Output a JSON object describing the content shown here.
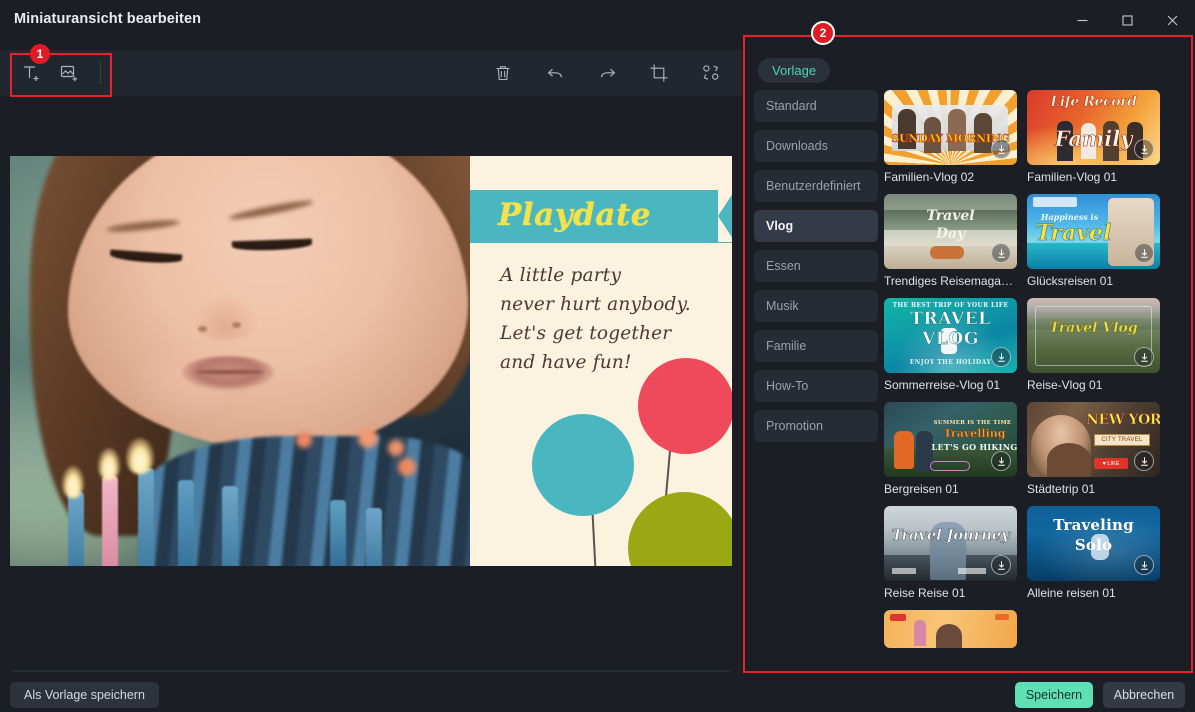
{
  "window": {
    "title": "Miniaturansicht bearbeiten",
    "controls": [
      {
        "name": "minimize",
        "glyph": "minimize-icon"
      },
      {
        "name": "maximize",
        "glyph": "maximize-icon"
      },
      {
        "name": "close",
        "glyph": "close-icon"
      }
    ]
  },
  "toolbar": {
    "left_tools": [
      {
        "name": "add-text-icon",
        "label": "Text hinzufügen"
      },
      {
        "name": "add-image-icon",
        "label": "Bild hinzufügen"
      }
    ],
    "right_tools": [
      {
        "name": "delete-icon",
        "label": "Löschen"
      },
      {
        "name": "undo-icon",
        "label": "Rückgängig"
      },
      {
        "name": "redo-icon",
        "label": "Wiederholen"
      },
      {
        "name": "crop-icon",
        "label": "Zuschneiden"
      },
      {
        "name": "transform-icon",
        "label": "Transformieren"
      }
    ]
  },
  "markers": [
    {
      "number": "1",
      "target": "toolbar-left-tools"
    },
    {
      "number": "2",
      "target": "template-panel"
    }
  ],
  "preview": {
    "ribbon_text": "Playdate",
    "body_lines": [
      "A little party",
      "never hurt anybody.",
      "Let's get together",
      "and have fun!"
    ],
    "colors": {
      "ribbon": "#49b6c0",
      "ribbon_text": "#f3e24a",
      "card_bg": "#fbf2e0",
      "balloon_red": "#ef4a5c",
      "balloon_teal": "#49b6c0",
      "balloon_olive": "#9aa814"
    }
  },
  "template_panel": {
    "tab": "Vorlage",
    "categories": [
      {
        "label": "Standard",
        "active": false
      },
      {
        "label": "Downloads",
        "active": false
      },
      {
        "label": "Benutzerdefiniert",
        "active": false
      },
      {
        "label": "Vlog",
        "active": true
      },
      {
        "label": "Essen",
        "active": false
      },
      {
        "label": "Musik",
        "active": false
      },
      {
        "label": "Familie",
        "active": false
      },
      {
        "label": "How-To",
        "active": false
      },
      {
        "label": "Promotion",
        "active": false
      }
    ],
    "templates": [
      {
        "label": "Familien-Vlog 02",
        "overlay": "SUNDAY MORNING",
        "downloadable": true,
        "style": "fam02"
      },
      {
        "label": "Familien-Vlog 01",
        "overlay": "Life Record Family",
        "downloadable": true,
        "style": "fam01"
      },
      {
        "label": "Trendiges Reisemagazi...",
        "overlay": "Travel Day",
        "downloadable": true,
        "style": "travelday"
      },
      {
        "label": "Glücksreisen 01",
        "overlay": "Travel",
        "downloadable": true,
        "style": "happytravel"
      },
      {
        "label": "Sommerreise-Vlog 01",
        "overlay": "TRAVEL VLOG",
        "downloadable": true,
        "style": "summer"
      },
      {
        "label": "Reise-Vlog 01",
        "overlay": "Travel Vlog",
        "downloadable": true,
        "style": "reisevlog"
      },
      {
        "label": "Bergreisen 01",
        "overlay": "LET'S GO HIKING",
        "downloadable": true,
        "style": "berg"
      },
      {
        "label": "Städtetrip 01",
        "overlay": "NEW YORK",
        "downloadable": true,
        "style": "newyork"
      },
      {
        "label": "Reise Reise 01",
        "overlay": "Travel Journey",
        "downloadable": true,
        "style": "journey"
      },
      {
        "label": "Alleine reisen 01",
        "overlay": "Traveling Solo",
        "downloadable": true,
        "style": "solo"
      },
      {
        "label": "",
        "overlay": "",
        "downloadable": false,
        "style": "partial"
      }
    ]
  },
  "footer": {
    "save_template_label": "Als Vorlage speichern",
    "save_label": "Speichern",
    "cancel_label": "Abbrechen",
    "save_color": "#5fe0b4"
  }
}
